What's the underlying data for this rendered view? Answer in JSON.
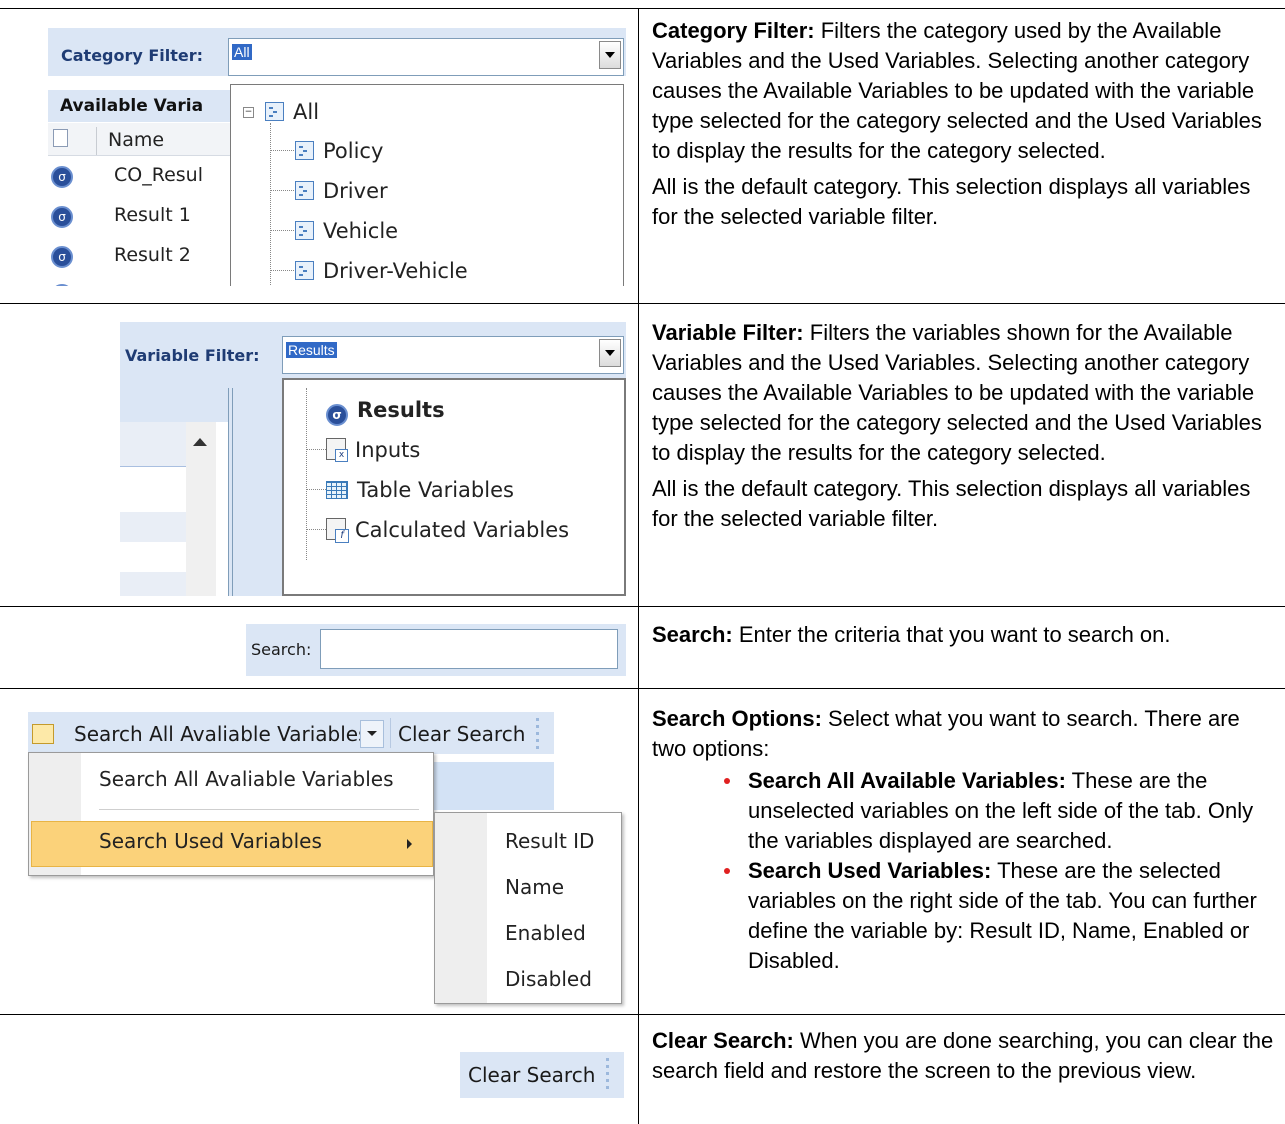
{
  "rows": [
    {
      "description": {
        "term": "Category Filter:",
        "text": "Filters the category used by the Available Variables and the Used Variables. Selecting another category causes the Available Variables to be updated with the variable type selected for the category selected and the Used Variables to display the results for the category selected.",
        "note": "All is the default category. This selection displays all variables for the selected variable filter."
      },
      "ui": {
        "label": "Category Filter:",
        "selected": "All",
        "panel_header": "Available Varia",
        "column_name": "Name",
        "list_items": [
          "CO_Resul",
          "Result 1",
          "Result 2"
        ],
        "tree_root": "All",
        "tree_items": [
          "Policy",
          "Driver",
          "Vehicle",
          "Driver-Vehicle"
        ]
      }
    },
    {
      "description": {
        "term": "Variable Filter:",
        "text": "Filters the variables shown for the Available Variables and the Used Variables. Selecting another category causes the Available Variables to be updated with the variable type selected for the category selected and the Used Variables to display the results for the category selected.",
        "note": "All is the default category. This selection displays all variables for the selected variable filter."
      },
      "ui": {
        "label": "Variable Filter:",
        "selected": "Results",
        "tree_items": [
          "Results",
          "Inputs",
          "Table Variables",
          "Calculated Variables"
        ]
      }
    },
    {
      "description": {
        "term": "Search:",
        "text": "Enter the criteria that you want to search on."
      },
      "ui": {
        "label": "Search:",
        "value": ""
      }
    },
    {
      "description": {
        "term": "Search Options:",
        "text": "Select what you want to search. There are two options:",
        "bullets": [
          {
            "term": "Search All Available Variables:",
            "text": "These are the unselected variables on the left side of the tab. Only the variables displayed are searched."
          },
          {
            "term": "Search Used Variables:",
            "text": "These are the selected variables on the right side of the tab. You can further define the variable by: Result ID, Name, Enabled or Disabled."
          }
        ]
      },
      "ui": {
        "dropdown_label": "Search All Avaliable Variables",
        "clear_label": "Clear Search",
        "menu_items": [
          "Search All Avaliable Variables",
          "Search Used Variables"
        ],
        "submenu_items": [
          "Result ID",
          "Name",
          "Enabled",
          "Disabled"
        ]
      }
    },
    {
      "description": {
        "term": "Clear Search:",
        "text": "When you are done searching, you can clear the search field and restore the screen to the previous view."
      },
      "ui": {
        "clear_label": "Clear Search"
      }
    }
  ],
  "colors": {
    "accent_blue": "#dbe6f5",
    "selection": "#3169c6",
    "highlight": "#fbd27a",
    "bullet": "#e02020"
  }
}
